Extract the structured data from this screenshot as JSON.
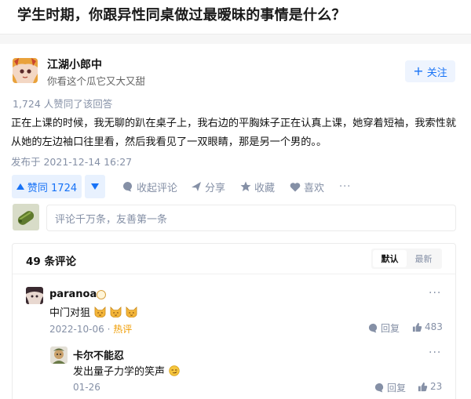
{
  "question": {
    "title": "学生时期，你跟异性同桌做过最暧昧的事情是什么？"
  },
  "answer": {
    "author": {
      "name": "江湖小郎中",
      "bio": "你看这个瓜它又大又甜"
    },
    "follow_label": "关注",
    "votes_summary": "1,724 人赞同了该回答",
    "text": "正在上课的时候，我无聊的趴在桌子上，我右边的平胸妹子正在认真上课，她穿着短袖，我索性就从她的左边袖口往里看，然后我看见了一双眼睛，那是另一个男的。。",
    "publish_time": "发布于 2021-12-14 16:27",
    "actions": {
      "upvote_label": "赞同 1724",
      "collapse_label": "收起评论",
      "share_label": "分享",
      "favorite_label": "收藏",
      "like_label": "喜欢",
      "more_label": "···"
    }
  },
  "comment_input": {
    "placeholder": "评论千万条，友善第一条"
  },
  "comments": {
    "count_label": "49 条评论",
    "sort": {
      "default_label": "默认",
      "latest_label": "最新",
      "active": "默认"
    },
    "items": [
      {
        "name": "paranoa",
        "text": "中门对狙",
        "emoji": [
          "cat-face-icon",
          "cat-face-icon",
          "cat-face-icon"
        ],
        "date": "2022-10-06",
        "hot_label": "热评",
        "reply_label": "回复",
        "likes": "483",
        "more": "···"
      },
      {
        "name": "卡尔不能忍",
        "text": "发出量子力学的笑声",
        "emoji": [
          "smirk-face-icon"
        ],
        "date": "01-26",
        "reply_label": "回复",
        "likes": "23",
        "more": "···"
      }
    ]
  },
  "colors": {
    "accent": "#1772f6",
    "accent_bg": "#e8f1fe",
    "muted": "#8590a6",
    "hot": "#f09c00"
  }
}
